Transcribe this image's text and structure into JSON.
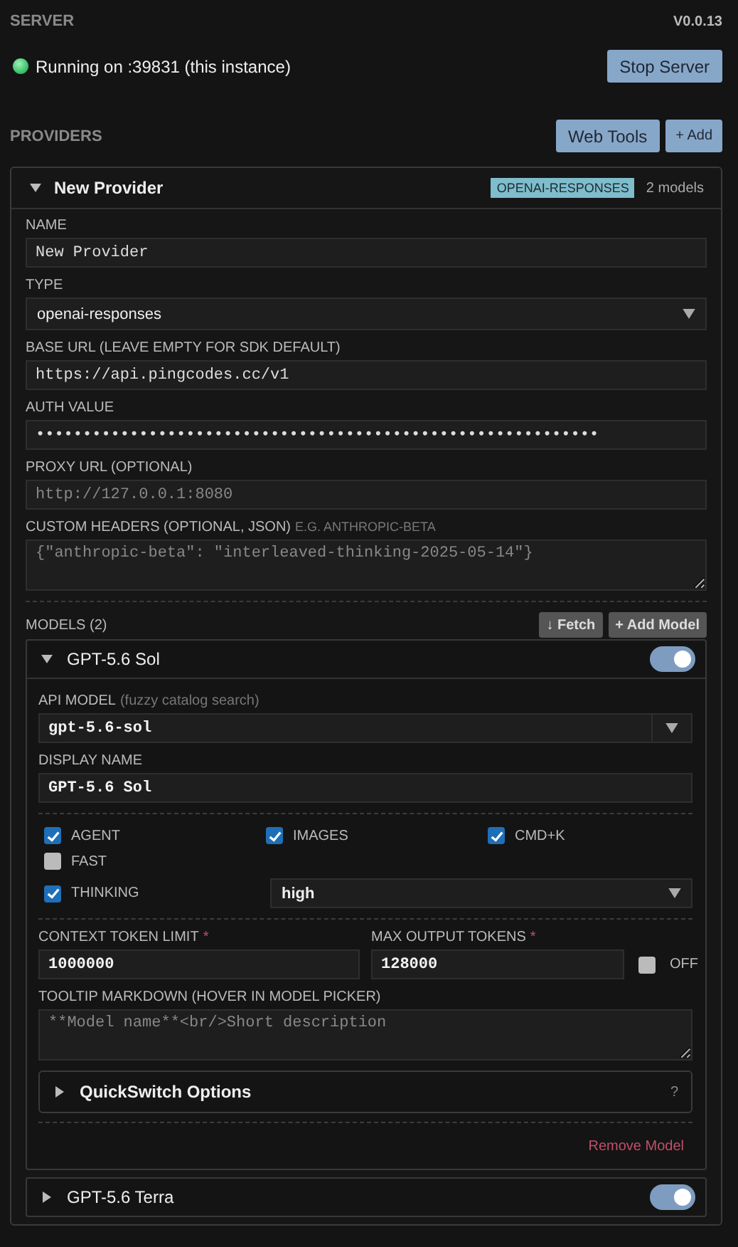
{
  "server": {
    "title": "SERVER",
    "version": "V0.0.13",
    "status": {
      "text": "Running on :39831 (this instance)",
      "running": true
    },
    "button": "Stop Server"
  },
  "providers": {
    "title": "PROVIDERS",
    "buttons": [
      "Web Tools",
      "+ Add"
    ],
    "items": [
      {
        "name": "New Provider",
        "expanded": true,
        "type_badge": "OPENAI-RESPONSES",
        "model_count": "2 models",
        "fields": [
          {
            "kind": "input",
            "label": "NAME",
            "value": "New Provider"
          },
          {
            "kind": "select",
            "label": "TYPE",
            "value": "openai-responses"
          },
          {
            "kind": "input",
            "label": "BASE URL (LEAVE EMPTY FOR SDK DEFAULT)",
            "value": "https://api.pingcodes.cc/v1"
          },
          {
            "kind": "input",
            "label": "AUTH VALUE",
            "value": "••••••••••••••••••••••••••••••••••••••••••••••••••••••••••••"
          },
          {
            "kind": "input",
            "label": "PROXY URL (OPTIONAL)",
            "placeholder": "http://127.0.0.1:8080"
          },
          {
            "kind": "textarea",
            "label": "CUSTOM HEADERS (OPTIONAL, JSON)",
            "hint": "E.G. ANTHROPIC-BETA",
            "placeholder": "{\"anthropic-beta\": \"interleaved-thinking-2025-05-14\"}"
          }
        ],
        "models_title": "MODELS (2)",
        "model_buttons": [
          "↓ Fetch",
          "+ Add Model"
        ],
        "models": [
          {
            "name": "GPT-5.6 Sol",
            "expanded": true,
            "enabled": true,
            "api_model": {
              "label": "API MODEL",
              "hint": "(fuzzy catalog search)",
              "value": "gpt-5.6-sol"
            },
            "display_name": {
              "label": "DISPLAY NAME",
              "value": "GPT-5.6 Sol"
            },
            "flags": [
              {
                "kind": "check",
                "label": "AGENT",
                "checked": true
              },
              {
                "kind": "check",
                "label": "IMAGES",
                "checked": true
              },
              {
                "kind": "check",
                "label": "CMD+K",
                "checked": true
              },
              {
                "kind": "check",
                "label": "FAST",
                "checked": false
              },
              {
                "kind": "check_select",
                "label": "THINKING",
                "checked": true,
                "value": "high"
              }
            ],
            "context_limit": {
              "label": "CONTEXT TOKEN LIMIT",
              "required_mark": "*",
              "value": "1000000"
            },
            "max_output": {
              "label": "MAX OUTPUT TOKENS",
              "required_mark": "*",
              "value": "128000",
              "off_label": "OFF",
              "off_checked": false
            },
            "tooltip": {
              "label": "TOOLTIP MARKDOWN (HOVER IN MODEL PICKER)",
              "placeholder": "**Model name**<br/>Short description"
            },
            "quickswitch": {
              "label": "QuickSwitch Options",
              "expanded": false,
              "help": "?"
            },
            "remove": "Remove Model"
          },
          {
            "name": "GPT-5.6 Terra",
            "expanded": false,
            "enabled": true
          }
        ]
      }
    ]
  }
}
